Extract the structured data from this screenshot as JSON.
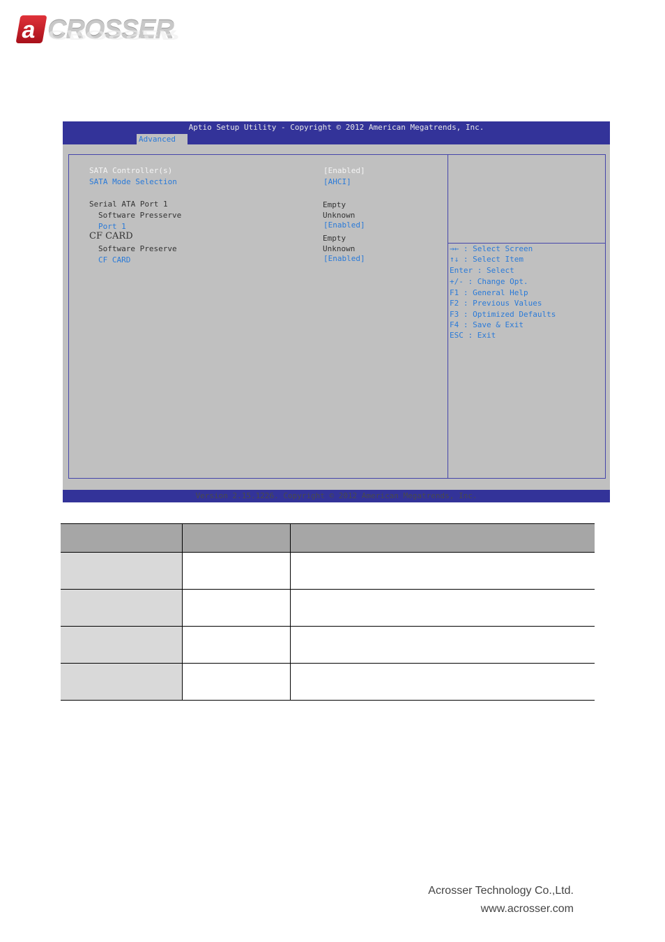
{
  "logo": {
    "letter": "a",
    "text": "CROSSER"
  },
  "bios": {
    "title": "Aptio Setup Utility - Copyright © 2012 American Megatrends, Inc.",
    "active_tab": "Advanced",
    "items": [
      {
        "label": "SATA Controller(s)",
        "value": "[Enabled]",
        "style": "selected"
      },
      {
        "label": "SATA Mode Selection",
        "value": "[AHCI]",
        "style": "option"
      },
      {
        "label": "Serial ATA Port 1",
        "value": "Empty",
        "style": "info"
      },
      {
        "label": "Software Presserve",
        "value": "Unknown",
        "style": "info"
      },
      {
        "label": "Port 1",
        "value": "[Enabled]",
        "style": "option"
      },
      {
        "label": "CF CARD",
        "value": "Empty",
        "style": "info"
      },
      {
        "label": "Software Preserve",
        "value": "Unknown",
        "style": "info"
      },
      {
        "label": "CF CARD",
        "value": "[Enabled]",
        "style": "option"
      }
    ],
    "help": [
      "→← : Select Screen",
      "↑↓ : Select Item",
      "Enter : Select",
      "+/- : Change Opt.",
      "F1 : General Help",
      "F2 : Previous Values",
      "F3 : Optimized Defaults",
      "F4 : Save & Exit",
      "ESC : Exit"
    ],
    "footer": "Version 2.15.1226. Copyright © 2012 American Megatrends, Inc."
  },
  "table": {
    "headers": [
      "",
      "",
      ""
    ],
    "rows": [
      [
        "",
        "",
        ""
      ],
      [
        "",
        "",
        ""
      ],
      [
        "",
        "",
        ""
      ],
      [
        "",
        "",
        ""
      ]
    ]
  },
  "company": "Acrosser Technology Co.,Ltd.",
  "website": "www.acrosser.com"
}
